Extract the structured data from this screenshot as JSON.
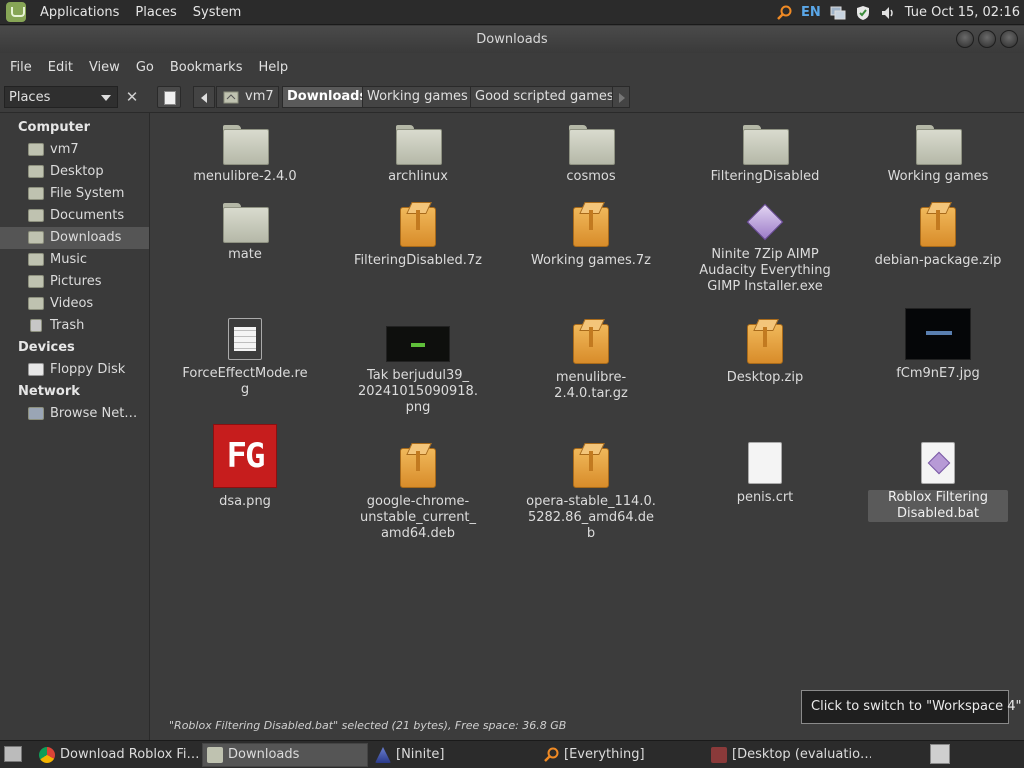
{
  "top_panel": {
    "menus": [
      "Applications",
      "Places",
      "System"
    ],
    "language": "EN",
    "clock": "Tue Oct 15, 02:16"
  },
  "window": {
    "title": "Downloads"
  },
  "menubar": [
    "File",
    "Edit",
    "View",
    "Go",
    "Bookmarks",
    "Help"
  ],
  "toolbar": {
    "places_label": "Places",
    "close_symbol": "✕",
    "breadcrumbs": [
      "vm7",
      "Downloads",
      "Working games",
      "Good scripted games"
    ],
    "active_crumb": "Downloads"
  },
  "sidebar": {
    "computer_heading": "Computer",
    "computer_items": [
      "vm7",
      "Desktop",
      "File System",
      "Documents",
      "Downloads",
      "Music",
      "Pictures",
      "Videos",
      "Trash"
    ],
    "selected_item": "Downloads",
    "devices_heading": "Devices",
    "devices_items": [
      "Floppy Disk"
    ],
    "network_heading": "Network",
    "network_items": [
      "Browse Net…"
    ]
  },
  "files": [
    {
      "name": "menulibre-2.4.0",
      "kind": "folder"
    },
    {
      "name": "archlinux",
      "kind": "folder"
    },
    {
      "name": "cosmos",
      "kind": "folder"
    },
    {
      "name": "FilteringDisabled",
      "kind": "folder"
    },
    {
      "name": "Working games",
      "kind": "folder"
    },
    {
      "name": "mate",
      "kind": "folder"
    },
    {
      "name": "FilteringDisabled.7z",
      "kind": "archive"
    },
    {
      "name": "Working games.7z",
      "kind": "archive"
    },
    {
      "name": "Ninite 7Zip AIMP Audacity Everything GIMP Installer.exe",
      "kind": "ninite"
    },
    {
      "name": "debian-package.zip",
      "kind": "archive"
    },
    {
      "name": "ForceEffectMode.reg",
      "kind": "text-doc"
    },
    {
      "name": "Tak berjudul39_ 20241015090918. png",
      "kind": "image-dark"
    },
    {
      "name": "menulibre-2.4.0.tar.gz",
      "kind": "archive"
    },
    {
      "name": "Desktop.zip",
      "kind": "archive"
    },
    {
      "name": "fCm9nE7.jpg",
      "kind": "image-black"
    },
    {
      "name": "dsa.png",
      "kind": "image-fg",
      "thumb_text": "FG"
    },
    {
      "name": "google-chrome- unstable_current_ amd64.deb",
      "kind": "archive"
    },
    {
      "name": "opera-stable_114.0. 5282.86_amd64.deb",
      "kind": "archive"
    },
    {
      "name": "penis.crt",
      "kind": "blank-doc"
    },
    {
      "name": "Roblox Filtering Disabled.bat",
      "kind": "script-doc",
      "selected": true
    }
  ],
  "status_text": "\"Roblox Filtering Disabled.bat\" selected (21 bytes), Free space: 36.8 GB",
  "tooltip": "Click to switch to \"Workspace 4\"",
  "taskbar": {
    "tasks": [
      {
        "label": "Download Roblox Fi…",
        "icon": "chrome-icon"
      },
      {
        "label": "Downloads",
        "icon": "folder-icon",
        "active": true
      },
      {
        "label": "[Ninite]",
        "icon": "ninite-icon"
      },
      {
        "label": "[Everything]",
        "icon": "search-icon"
      },
      {
        "label": "[Desktop (evaluatio…",
        "icon": "window-icon"
      }
    ]
  },
  "colors": {
    "background": "#3c3c3c",
    "panel": "#2b2b2b",
    "accent_lang": "#5aa7e8",
    "archive": "#e3a040",
    "fg_thumb": "#c61d1d"
  }
}
